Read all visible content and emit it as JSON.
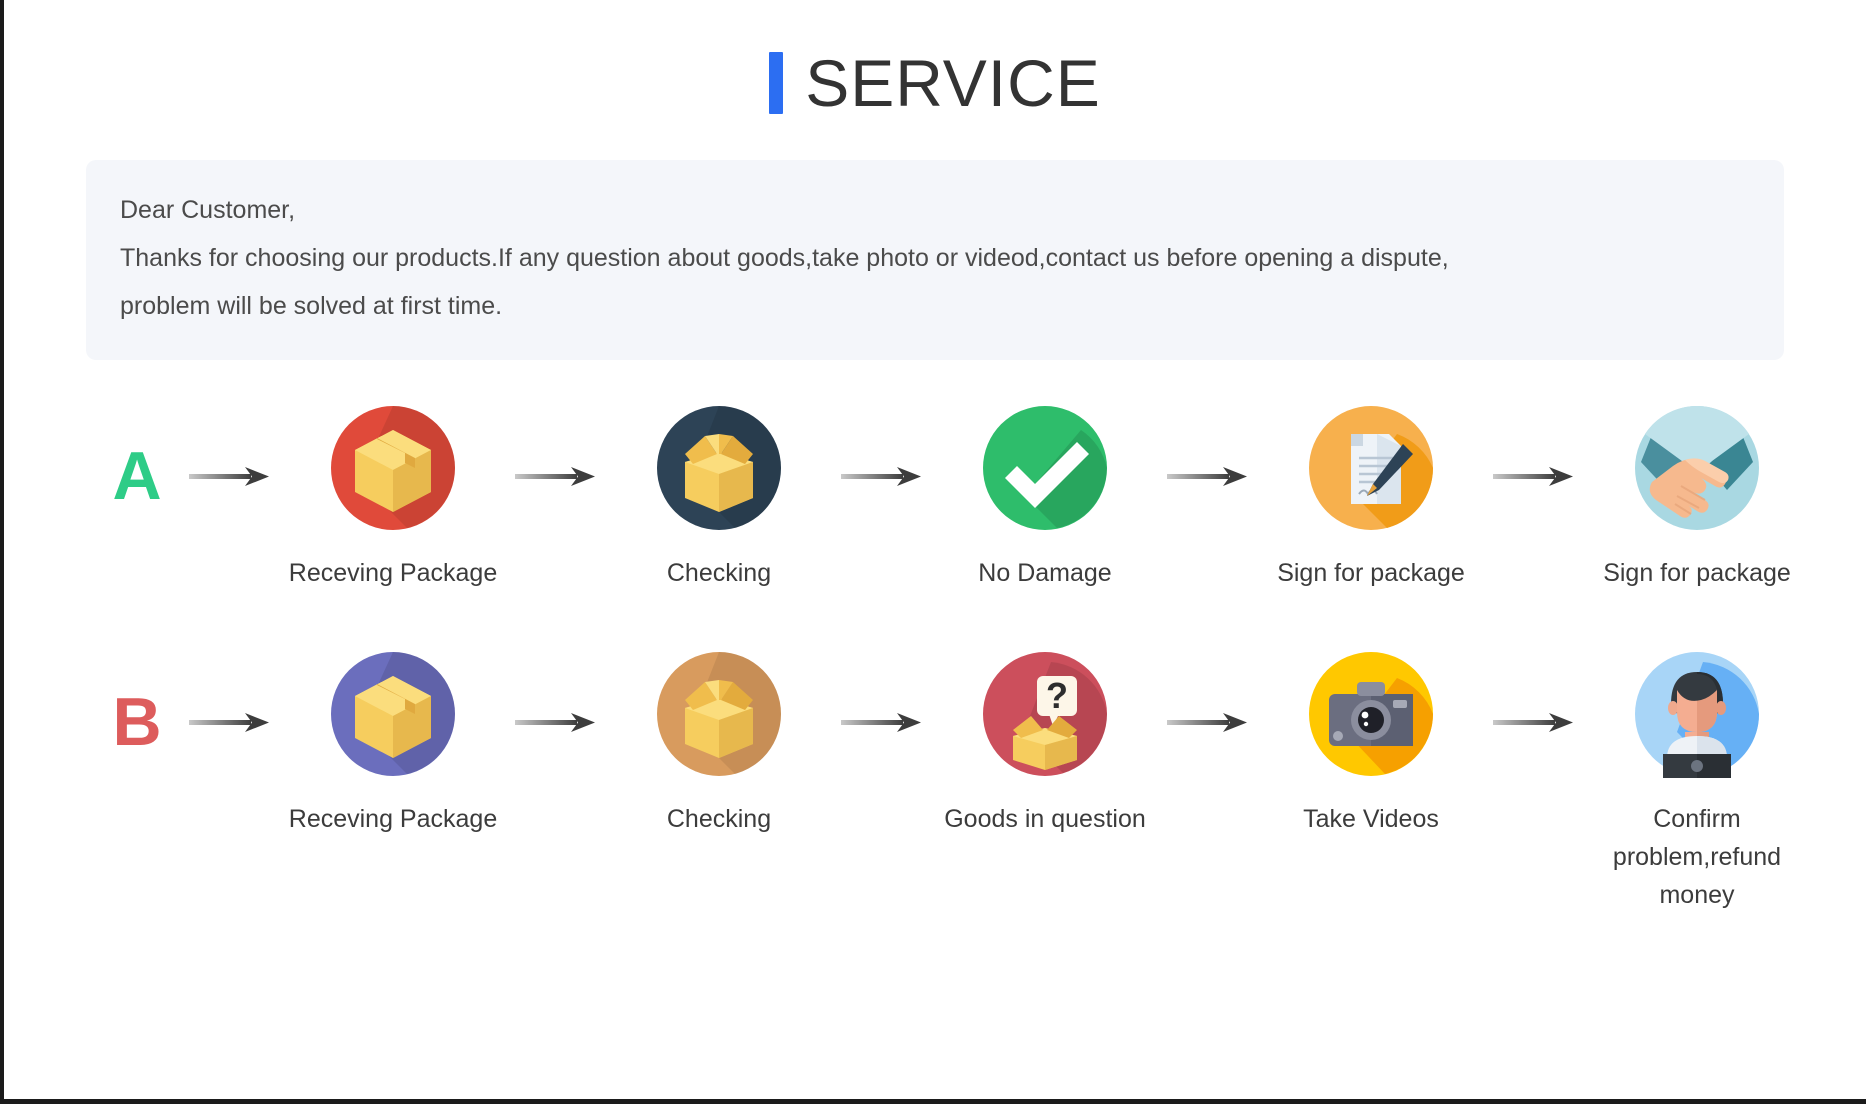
{
  "header": {
    "title": "SERVICE",
    "accent_color": "#2c6ef2"
  },
  "notice": {
    "line1": "Dear Customer,",
    "line2": "Thanks for choosing our products.If any question about goods,take photo or videod,contact us before opening a dispute,",
    "line3": "problem will be solved at first time.",
    "background_color": "#f4f6fa"
  },
  "flows": [
    {
      "badge": "A",
      "badge_color": "#2ecc87",
      "steps": [
        {
          "label": "Receving Package",
          "icon": "closed-package-icon",
          "circle_color": "#e04a3a"
        },
        {
          "label": "Checking",
          "icon": "open-box-icon",
          "circle_color": "#2d4356"
        },
        {
          "label": "No Damage",
          "icon": "check-mark-icon",
          "circle_color": "#2ebd6b"
        },
        {
          "label": "Sign for package",
          "icon": "sign-document-icon",
          "circle_color": "#f5a93c"
        },
        {
          "label": "Sign for package",
          "icon": "handshake-icon",
          "circle_color": "#a9d8e2"
        }
      ]
    },
    {
      "badge": "B",
      "badge_color": "#dd5c5c",
      "steps": [
        {
          "label": "Receving Package",
          "icon": "closed-package-icon",
          "circle_color": "#6b6ebd"
        },
        {
          "label": "Checking",
          "icon": "open-box-icon",
          "circle_color": "#d89b5e"
        },
        {
          "label": "Goods in question",
          "icon": "question-box-icon",
          "circle_color": "#cc4f5c"
        },
        {
          "label": "Take Videos",
          "icon": "camera-icon",
          "circle_color": "#ffc800"
        },
        {
          "label": "Confirm problem,refund money",
          "icon": "support-agent-icon",
          "circle_color": "#a8d5f7"
        }
      ]
    }
  ],
  "arrow": {
    "name": "right-arrow-icon",
    "color": "#4a4a4a"
  }
}
